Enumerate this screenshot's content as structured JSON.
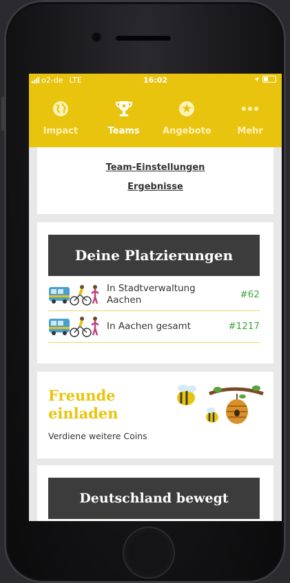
{
  "status_bar": {
    "carrier": "o2-de",
    "network": "LTE",
    "time": "16:02"
  },
  "tabs": [
    {
      "label": "Impact",
      "icon": "globe-icon",
      "active": false
    },
    {
      "label": "Teams",
      "icon": "trophy-icon",
      "active": true
    },
    {
      "label": "Angebote",
      "icon": "star-icon",
      "active": false
    },
    {
      "label": "Mehr",
      "icon": "more-dots-icon",
      "active": false
    }
  ],
  "team_links": {
    "settings": "Team-Einstellungen",
    "results": "Ergebnisse"
  },
  "placements": {
    "title": "Deine Platzierungen",
    "rows": [
      {
        "label": "In Stadtverwaltung Aachen",
        "rank": "#62"
      },
      {
        "label": "In Aachen gesamt",
        "rank": "#1217"
      }
    ]
  },
  "invite": {
    "title": "Freunde einladen",
    "subtitle": "Verdiene weitere Coins"
  },
  "germany": {
    "title": "Deutschland bewegt"
  },
  "colors": {
    "brand_yellow": "#e9c40e",
    "rank_green": "#3aa535",
    "header_dark": "#3c3c3c"
  }
}
